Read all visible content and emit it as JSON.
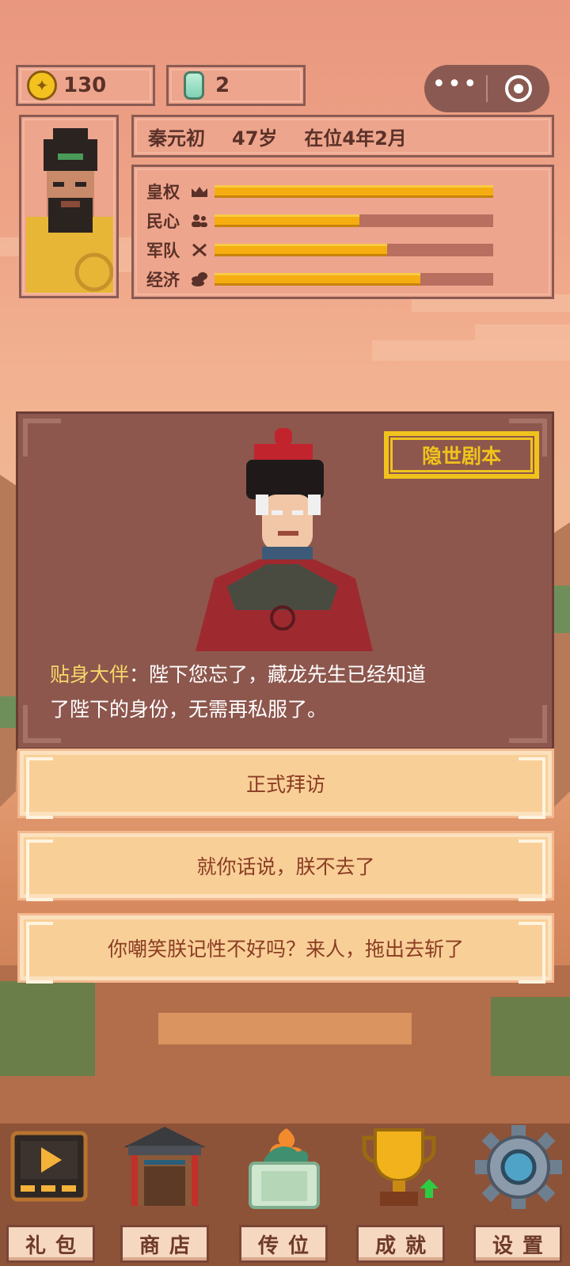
{
  "resources": {
    "coins": "130",
    "jade": "2"
  },
  "emperor": {
    "name": "秦元初",
    "age": "47岁",
    "reign": "在位4年2月"
  },
  "stats": [
    {
      "label": "皇权",
      "icon": "crown-icon",
      "value": 1.0
    },
    {
      "label": "民心",
      "icon": "people-icon",
      "value": 0.52
    },
    {
      "label": "军队",
      "icon": "swords-icon",
      "value": 0.62
    },
    {
      "label": "经济",
      "icon": "coins-icon",
      "value": 0.74
    }
  ],
  "dialog": {
    "tag": "隐世剧本",
    "speaker": "贴身大伴",
    "separator": "：",
    "text_line1": "陛下您忘了，藏龙先生已经知道",
    "text_line2": "了陛下的身份，无需再私服了。"
  },
  "choices": [
    "正式拜访",
    "就你话说，朕不去了",
    "你嘲笑朕记性不好吗？来人，拖出去斩了"
  ],
  "nav": [
    {
      "label": "礼包",
      "icon": "video-play-icon"
    },
    {
      "label": "商店",
      "icon": "shop-icon"
    },
    {
      "label": "传位",
      "icon": "jade-seal-icon"
    },
    {
      "label": "成就",
      "icon": "trophy-icon"
    },
    {
      "label": "设置",
      "icon": "gear-icon"
    }
  ],
  "colors": {
    "bar_fill": "#f5ad12",
    "dialog_bg": "#8d574d",
    "choice_bg": "#f9cf98",
    "tag": "#f0c31c"
  }
}
